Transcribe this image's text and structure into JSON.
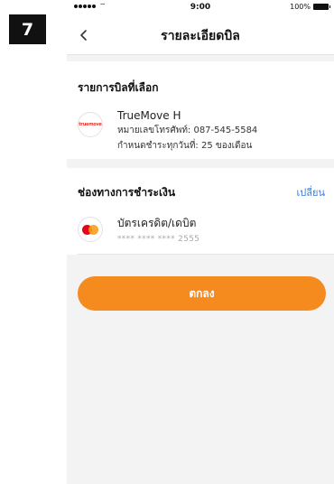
{
  "step_badge": "7",
  "status_bar": {
    "time": "9:00",
    "battery": "100%",
    "wifi_glyph": "⌔"
  },
  "nav": {
    "title": "รายละเอียดบิล",
    "back_icon": "chevron-left-icon"
  },
  "bill_section": {
    "title": "รายการบิลที่เลือก",
    "logo_text": "truemove",
    "name": "TrueMove H",
    "phone": "หมายเลขโทรศัพท์: 087-545-5584",
    "due": "กำหนดชำระทุกวันที่: 25 ของเดือน"
  },
  "payment_section": {
    "title": "ช่องทางการชำระเงิน",
    "change_label": "เปลี่ยน",
    "card_type": "บัตรเครดิต/เดบิต",
    "card_number": "**** **** **** 2555"
  },
  "confirm_button": "ตกลง",
  "colors": {
    "accent": "#f58a1f",
    "link": "#3a7bd5",
    "brand_red": "#e6352b"
  }
}
